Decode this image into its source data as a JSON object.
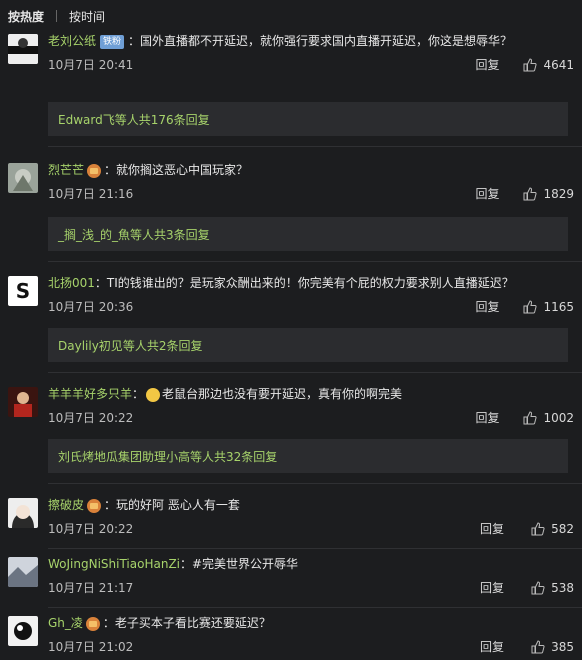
{
  "sort": {
    "hot": "按热度",
    "time": "按时间"
  },
  "comments": [
    {
      "user": "老刘公纸",
      "badge": "铁粉",
      "text": "：国外直播都不开延迟，就你强行要求国内直播开延迟，你这是想辱华？",
      "time": "10月7日 20:41",
      "reply": "回复",
      "likes": "4641",
      "sub": {
        "names": "Edward飞",
        "mid": " 等人 ",
        "count": "共176条回复"
      }
    },
    {
      "user": "烈芒芒",
      "text": "：就你搁这恶心中国玩家？",
      "time": "10月7日 21:16",
      "reply": "回复",
      "likes": "1829",
      "sub": {
        "names": "_搁_浅_的_魚",
        "mid": " 等人 ",
        "count": "共3条回复"
      }
    },
    {
      "user": "北扬001",
      "text": "：TI的钱谁出的？是玩家众酬出来的！你完美有个屁的权力要求别人直播延迟？",
      "time": "10月7日 20:36",
      "reply": "回复",
      "likes": "1165",
      "sub": {
        "names": "Daylily初见",
        "mid": " 等人 ",
        "count": "共2条回复"
      }
    },
    {
      "user": "羊羊羊好多只羊",
      "text": "老鼠台那边也没有要开延迟，真有你的啊完美",
      "time": "10月7日 20:22",
      "reply": "回复",
      "likes": "1002",
      "sub": {
        "names": "刘氏烤地瓜集团助理小高",
        "mid": " 等人 ",
        "count": "共32条回复"
      }
    },
    {
      "user": "擦破皮",
      "text": "：玩的好阿 恶心人有一套",
      "time": "10月7日 20:22",
      "reply": "回复",
      "likes": "582"
    },
    {
      "user": "WoJingNiShiTiaoHanZi",
      "text": "：#完美世界公开辱华",
      "time": "10月7日 21:17",
      "reply": "回复",
      "likes": "538"
    },
    {
      "user": "Gh_凌",
      "text": "：老子买本子看比赛还要延迟？",
      "time": "10月7日 21:02",
      "reply": "回复",
      "likes": "385"
    }
  ]
}
